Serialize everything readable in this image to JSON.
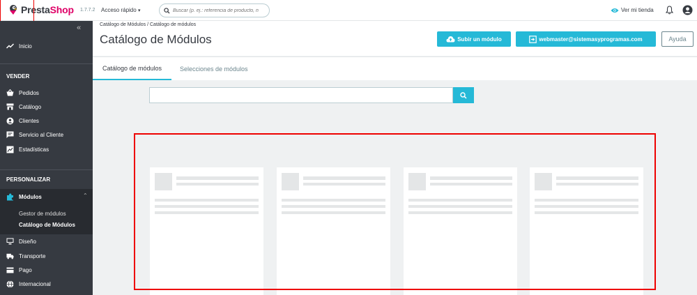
{
  "header": {
    "brand_a": "Presta",
    "brand_b": "Shop",
    "version": "1.7.7.2",
    "quick_access": "Acceso rápido",
    "search_placeholder": "Buscar (p. ej.: referencia de producto, n",
    "view_shop": "Ver mi tienda"
  },
  "sidebar": {
    "home": "Inicio",
    "sections": [
      {
        "title": "VENDER",
        "items": [
          "Pedidos",
          "Catálogo",
          "Clientes",
          "Servicio al Cliente",
          "Estadísticas"
        ]
      },
      {
        "title": "PERSONALIZAR",
        "items": [
          "Módulos",
          "Diseño",
          "Transporte",
          "Pago",
          "Internacional"
        ]
      }
    ],
    "modules_sub": [
      "Gestor de módulos",
      "Catálogo de Módulos"
    ]
  },
  "page": {
    "breadcrumb": "Catálogo de Módulos  /  Catálogo de módulos",
    "title": "Catálogo de Módulos",
    "upload_button": "Subir un módulo",
    "account_button": "webmaster@sistemasyprogramas.com",
    "help_button": "Ayuda"
  },
  "tabs": [
    "Catálogo de módulos",
    "Selecciones de módulos"
  ],
  "colors": {
    "accent": "#25b9d7",
    "brand": "#df0067",
    "sidebar": "#363a41",
    "highlight": "#e00000"
  }
}
